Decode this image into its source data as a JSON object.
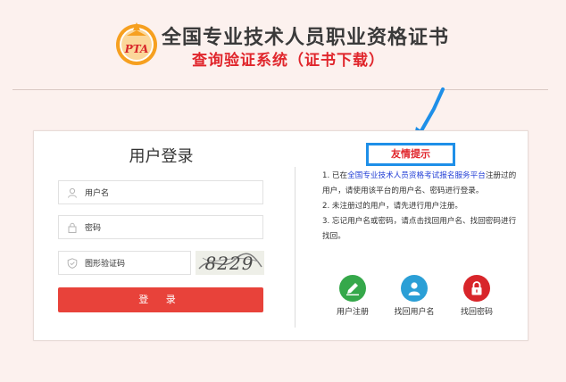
{
  "header": {
    "logo_text": "PTA",
    "title": "全国专业技术人员职业资格证书",
    "subtitle": "查询验证系统（证书下载）"
  },
  "login": {
    "title": "用户登录",
    "username_placeholder": "用户名",
    "password_placeholder": "密码",
    "captcha_placeholder": "图形验证码",
    "captcha_text": "8229",
    "submit_label": "登 录"
  },
  "tips": {
    "heading": "友情提示",
    "item1_prefix": "1. 已在",
    "item1_link": "全国专业技术人员资格考试报名服务平台",
    "item1_suffix": "注册过的用户，请使用该平台的用户名、密码进行登录。",
    "item2": "2. 未注册过的用户，请先进行用户注册。",
    "item3": "3. 忘记用户名或密码，请点击找回用户名、找回密码进行找回。"
  },
  "actions": {
    "register": "用户注册",
    "recover_username": "找回用户名",
    "recover_password": "找回密码"
  },
  "colors": {
    "accent_red": "#e8423a",
    "title_red": "#e0262c",
    "highlight_blue": "#1e8fe8",
    "register_green": "#35a84a",
    "username_blue": "#2b9fd6",
    "password_red": "#d8252a"
  }
}
